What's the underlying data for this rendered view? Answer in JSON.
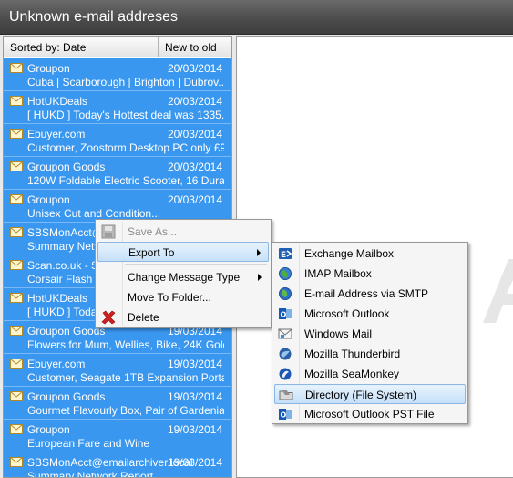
{
  "window": {
    "title": "Unknown e-mail addreses"
  },
  "list": {
    "sort_label": "Sorted by: Date",
    "order_label": "New to old",
    "rows": [
      {
        "sender": "Groupon",
        "date": "20/03/2014",
        "subject": "Cuba | Scarborough | Brighton | Dubrov..."
      },
      {
        "sender": "HotUKDeals",
        "date": "20/03/2014",
        "subject": "[ HUKD ] Today's Hottest deal was 1335..."
      },
      {
        "sender": "Ebuyer.com",
        "date": "20/03/2014",
        "subject": "Customer, Zoostorm Desktop PC only £9..."
      },
      {
        "sender": "Groupon Goods",
        "date": "20/03/2014",
        "subject": "120W Foldable Electric Scooter, 16 Dura..."
      },
      {
        "sender": "Groupon",
        "date": "20/03/2014",
        "subject": "Unisex Cut and Condition..."
      },
      {
        "sender": "SBSMonAcct@e",
        "date": "",
        "subject": "Summary Netwo"
      },
      {
        "sender": "Scan.co.uk - Sc",
        "date": "",
        "subject": "Corsair Flash Vo"
      },
      {
        "sender": "HotUKDeals",
        "date": "",
        "subject": "[ HUKD ] Today"
      },
      {
        "sender": "Groupon Goods",
        "date": "19/03/2014",
        "subject": "Flowers for Mum, Wellies, Bike, 24K Gold..."
      },
      {
        "sender": "Ebuyer.com",
        "date": "19/03/2014",
        "subject": "Customer, Seagate 1TB Expansion Porta..."
      },
      {
        "sender": "Groupon Goods",
        "date": "19/03/2014",
        "subject": "Gourmet Flavourly Box, Pair of Gardenia ..."
      },
      {
        "sender": "Groupon",
        "date": "19/03/2014",
        "subject": "European Fare and Wine"
      },
      {
        "sender": "SBSMonAcct@emailarchiver.local",
        "date": "19/03/2014",
        "subject": "Summary Network Report..."
      }
    ]
  },
  "context_menu": {
    "save_as": "Save As...",
    "export_to": "Export To",
    "change_message_type": "Change Message Type",
    "move_to_folder": "Move To Folder...",
    "delete": "Delete"
  },
  "export_submenu": {
    "items": [
      {
        "label": "Exchange Mailbox",
        "icon": "exchange-icon"
      },
      {
        "label": "IMAP Mailbox",
        "icon": "imap-globe-icon"
      },
      {
        "label": "E-mail Address via SMTP",
        "icon": "smtp-globe-icon"
      },
      {
        "label": "Microsoft Outlook",
        "icon": "outlook-icon"
      },
      {
        "label": "Windows Mail",
        "icon": "windows-mail-icon"
      },
      {
        "label": "Mozilla Thunderbird",
        "icon": "thunderbird-icon"
      },
      {
        "label": "Mozilla SeaMonkey",
        "icon": "seamonkey-icon"
      },
      {
        "label": "Directory (File System)",
        "icon": "folder-icon"
      },
      {
        "label": "Microsoft Outlook PST File",
        "icon": "outlook-pst-icon"
      }
    ]
  },
  "colors": {
    "row_selected": "#3a97ef",
    "menu_highlight": "#c6e0f8",
    "titlebar": "#4a4a4a"
  }
}
